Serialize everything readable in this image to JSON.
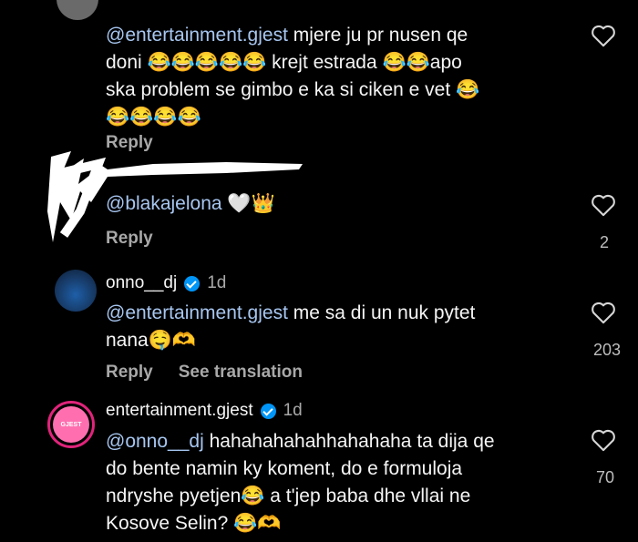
{
  "comments": [
    {
      "mention": "@entertainment.gjest",
      "lines": [
        " mjere ju pr nusen qe",
        "doni 😂😂😂😂😂 krejt estrada 😂😂apo",
        "ska problem se gimbo e ka si ciken e vet 😂",
        "😂😂😂😂"
      ],
      "reply_label": "Reply"
    },
    {
      "mention": "@blakajelona",
      "text": " 🤍👑",
      "reply_label": "Reply",
      "like_count": "2"
    },
    {
      "username": "onno__dj",
      "time": "1d",
      "mention": "@entertainment.gjest",
      "lines": [
        " me sa di un nuk pytet",
        "nana🤤🫶"
      ],
      "reply_label": "Reply",
      "translate_label": "See translation",
      "like_count": "203"
    },
    {
      "username": "entertainment.gjest",
      "time": "1d",
      "mention": "@onno__dj",
      "lines": [
        " hahahahahahhahahaha ta dija qe",
        "do bente namin ky koment, do e formuloja",
        "ndryshe pyetjen😂 a t'jep baba dhe vllai ne",
        "Kosove Selin? 😂🫶"
      ],
      "like_count": "70",
      "avatar_text": "GJEST"
    }
  ],
  "colors": {
    "mention": "#a7c6f0",
    "verified": "#0095f6",
    "muted": "#a8a8a8"
  }
}
